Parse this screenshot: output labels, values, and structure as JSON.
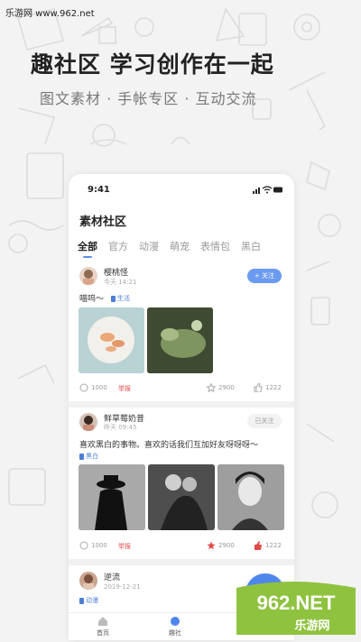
{
  "watermark_top": "乐游网 www.962.net",
  "headline": "趣社区  学习创作在一起",
  "subheadline": "图文素材 · 手帐专区 · 互动交流",
  "phone": {
    "time": "9:41",
    "page_title": "素材社区",
    "tabs": [
      "全部",
      "官方",
      "动漫",
      "萌宠",
      "表情包",
      "黑白"
    ],
    "posts": [
      {
        "username": "樱桃怪",
        "time": "今天  14:21",
        "follow_label": "+ 关注",
        "text": "喵呜～",
        "tag": "生活",
        "views": "1000",
        "report": "举报",
        "stars": "2900",
        "likes": "1222"
      },
      {
        "username": "鲜草莓奶昔",
        "time": "昨天  09:45",
        "follow_label": "已关注",
        "text": "喜欢黑白的事物。喜欢的话我们互加好友呀呀呀～",
        "tag": "黑白",
        "views": "1000",
        "report": "举报",
        "stars": "2900",
        "likes": "1222"
      },
      {
        "username": "逆流",
        "time": "2019-12-21",
        "tag": "动漫"
      }
    ],
    "nav": [
      "首页",
      "趣社"
    ]
  },
  "watermark": {
    "line1": "962.NET",
    "line2": "乐游网"
  },
  "colors": {
    "accent": "#5b8ef2",
    "report": "#e24a4a",
    "like_active": "#e24a4a"
  }
}
